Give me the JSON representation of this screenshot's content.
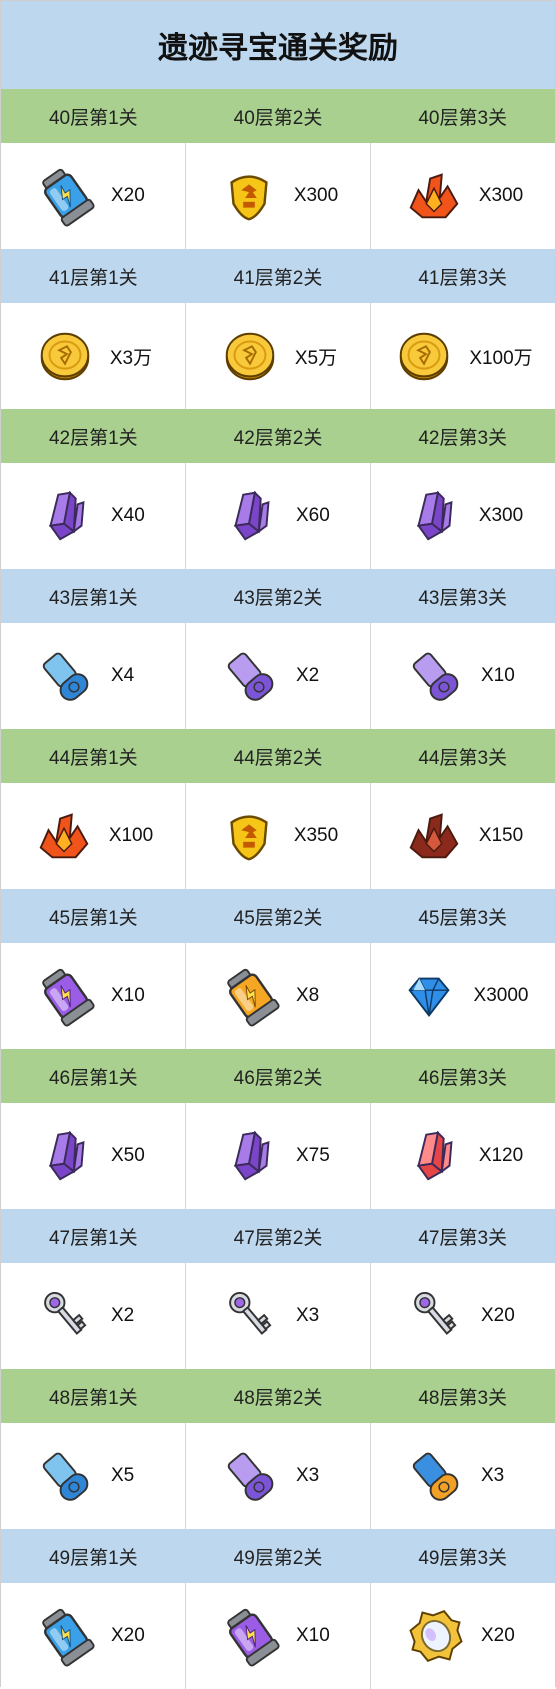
{
  "title": "遗迹寻宝通关奖励",
  "colors": {
    "header_blue": "#bdd7ee",
    "header_green": "#a9d08e"
  },
  "floors": [
    {
      "header_style": "green",
      "labels": [
        "40层第1关",
        "40层第2关",
        "40层第3关"
      ],
      "rewards": [
        {
          "icon": "blue-battery-icon",
          "qty": "X20"
        },
        {
          "icon": "gold-badge-icon",
          "qty": "X300"
        },
        {
          "icon": "fire-crystal-icon",
          "qty": "X300"
        }
      ]
    },
    {
      "header_style": "blue",
      "labels": [
        "41层第1关",
        "41层第2关",
        "41层第3关"
      ],
      "rewards": [
        {
          "icon": "gold-coin-icon",
          "qty": "X3万"
        },
        {
          "icon": "gold-coin-icon",
          "qty": "X5万"
        },
        {
          "icon": "gold-coin-icon",
          "qty": "X100万"
        }
      ]
    },
    {
      "header_style": "green",
      "labels": [
        "42层第1关",
        "42层第2关",
        "42层第3关"
      ],
      "rewards": [
        {
          "icon": "purple-crystal-icon",
          "qty": "X40"
        },
        {
          "icon": "purple-crystal-icon",
          "qty": "X60"
        },
        {
          "icon": "purple-crystal-icon",
          "qty": "X300"
        }
      ]
    },
    {
      "header_style": "blue",
      "labels": [
        "43层第1关",
        "43层第2关",
        "43层第3关"
      ],
      "rewards": [
        {
          "icon": "blue-scroll-icon",
          "qty": "X4"
        },
        {
          "icon": "purple-scroll-icon",
          "qty": "X2"
        },
        {
          "icon": "purple-scroll-icon",
          "qty": "X10"
        }
      ]
    },
    {
      "header_style": "green",
      "labels": [
        "44层第1关",
        "44层第2关",
        "44层第3关"
      ],
      "rewards": [
        {
          "icon": "fire-crystal-icon",
          "qty": "X100"
        },
        {
          "icon": "gold-badge-icon",
          "qty": "X350"
        },
        {
          "icon": "dark-red-crystal-icon",
          "qty": "X150"
        }
      ]
    },
    {
      "header_style": "blue",
      "labels": [
        "45层第1关",
        "45层第2关",
        "45层第3关"
      ],
      "rewards": [
        {
          "icon": "purple-battery-icon",
          "qty": "X10"
        },
        {
          "icon": "orange-battery-icon",
          "qty": "X8"
        },
        {
          "icon": "blue-diamond-icon",
          "qty": "X3000"
        }
      ]
    },
    {
      "header_style": "green",
      "labels": [
        "46层第1关",
        "46层第2关",
        "46层第3关"
      ],
      "rewards": [
        {
          "icon": "purple-crystal-icon",
          "qty": "X50"
        },
        {
          "icon": "purple-crystal-icon",
          "qty": "X75"
        },
        {
          "icon": "red-crystal-icon",
          "qty": "X120"
        }
      ]
    },
    {
      "header_style": "blue",
      "labels": [
        "47层第1关",
        "47层第2关",
        "47层第3关"
      ],
      "rewards": [
        {
          "icon": "silver-key-icon",
          "qty": "X2"
        },
        {
          "icon": "silver-key-icon",
          "qty": "X3"
        },
        {
          "icon": "silver-key-icon",
          "qty": "X20"
        }
      ]
    },
    {
      "header_style": "green",
      "labels": [
        "48层第1关",
        "48层第2关",
        "48层第3关"
      ],
      "rewards": [
        {
          "icon": "blue-scroll-icon",
          "qty": "X5"
        },
        {
          "icon": "purple-scroll-icon",
          "qty": "X3"
        },
        {
          "icon": "orange-scroll-icon",
          "qty": "X3"
        }
      ]
    },
    {
      "header_style": "blue",
      "labels": [
        "49层第1关",
        "49层第2关",
        "49层第3关"
      ],
      "rewards": [
        {
          "icon": "blue-battery-icon",
          "qty": "X20"
        },
        {
          "icon": "purple-battery-icon",
          "qty": "X10"
        },
        {
          "icon": "mirror-gem-icon",
          "qty": "X20"
        }
      ]
    }
  ]
}
